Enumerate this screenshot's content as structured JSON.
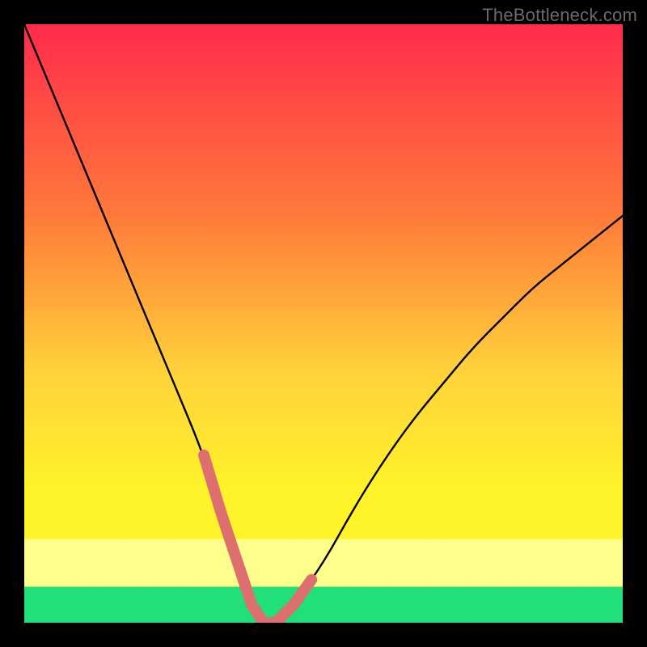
{
  "watermark": "TheBottleneck.com",
  "colors": {
    "frame": "#000000",
    "grad_top": "#ff2b4b",
    "grad_mid1": "#ff7a3a",
    "grad_mid2": "#ffd23a",
    "grad_mid3": "#fff32a",
    "grad_band": "#fdff8a",
    "grad_bottom": "#21e07a",
    "curve": "#000000",
    "marker": "#dd6f6f"
  },
  "chart_data": {
    "type": "line",
    "title": "",
    "xlabel": "",
    "ylabel": "",
    "xlim": [
      0,
      100
    ],
    "ylim": [
      0,
      100
    ],
    "series": [
      {
        "name": "bottleneck-curve",
        "x": [
          0,
          5,
          10,
          15,
          20,
          25,
          30,
          33,
          36,
          38,
          40,
          42,
          45,
          50,
          55,
          60,
          65,
          70,
          75,
          80,
          85,
          90,
          95,
          100
        ],
        "y": [
          100,
          88,
          76,
          64,
          52,
          40,
          28,
          18,
          9,
          3,
          0,
          0,
          3,
          10,
          19,
          27,
          34,
          40,
          46,
          51,
          56,
          60,
          64,
          68
        ]
      }
    ],
    "optimal_range_x": [
      33,
      45
    ],
    "optimal_value_x": 40,
    "annotations": {
      "left_marker_x_range": [
        30,
        37
      ],
      "right_marker_x_range": [
        43,
        48
      ],
      "bottom_marker_x_range": [
        36,
        44
      ]
    }
  }
}
